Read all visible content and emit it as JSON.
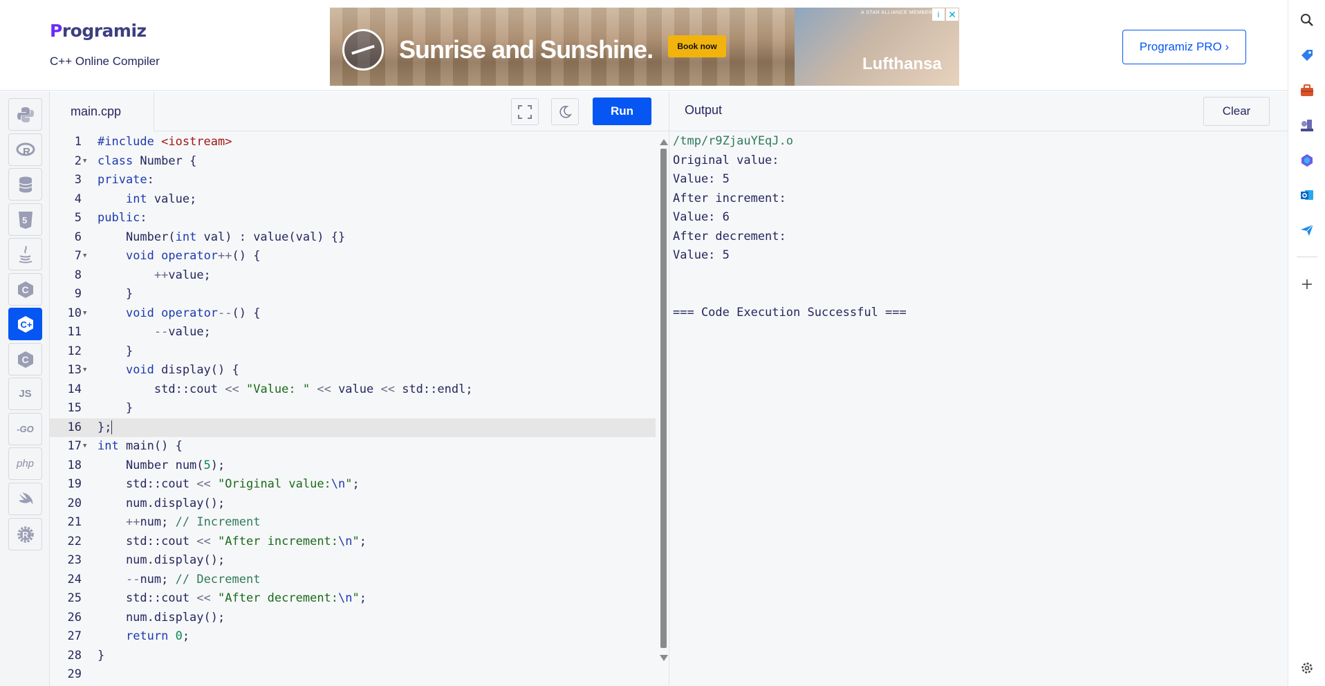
{
  "header": {
    "logo_p": "P",
    "logo_text": "rogramiz",
    "subtitle": "C++ Online Compiler",
    "pro_button": "Programiz PRO ›"
  },
  "ad": {
    "headline": "Sunrise and Sunshine.",
    "cta": "Book now",
    "brand": "Lufthansa",
    "small_text": "A STAR ALLIANCE MEMBER",
    "info": "i",
    "close": "✕"
  },
  "languages": [
    {
      "name": "python",
      "label": ""
    },
    {
      "name": "r",
      "label": "R"
    },
    {
      "name": "sql",
      "label": ""
    },
    {
      "name": "html",
      "label": "5"
    },
    {
      "name": "java",
      "label": ""
    },
    {
      "name": "c",
      "label": "C"
    },
    {
      "name": "cpp",
      "label": "C+",
      "active": true
    },
    {
      "name": "csharp",
      "label": "C"
    },
    {
      "name": "javascript",
      "label": "JS"
    },
    {
      "name": "go",
      "label": "-GO"
    },
    {
      "name": "php",
      "label": "php"
    },
    {
      "name": "swift",
      "label": ""
    },
    {
      "name": "rust",
      "label": "R"
    }
  ],
  "editor": {
    "filename": "main.cpp",
    "run_label": "Run",
    "active_line": 16,
    "line_numbers": [
      "1",
      "2",
      "3",
      "4",
      "5",
      "6",
      "7",
      "8",
      "9",
      "10",
      "11",
      "12",
      "13",
      "14",
      "15",
      "16",
      "17",
      "18",
      "19",
      "20",
      "21",
      "22",
      "23",
      "24",
      "25",
      "26",
      "27",
      "28",
      "29"
    ],
    "folds": [
      2,
      7,
      10,
      13,
      17
    ]
  },
  "output": {
    "title": "Output",
    "clear_label": "Clear",
    "lines": [
      "/tmp/r9ZjauYEqJ.o",
      "Original value:",
      "Value: 5",
      "After increment:",
      "Value: 6",
      "After decrement:",
      "Value: 5",
      "",
      "",
      "=== Code Execution Successful ==="
    ]
  },
  "browser_sidebar": {
    "icons": [
      "search-icon",
      "tag-icon",
      "toolbox-icon",
      "chess-icon",
      "copilot-icon",
      "outlook-icon",
      "send-icon",
      "add-icon",
      "settings-icon"
    ]
  },
  "colors": {
    "accent": "#0556f3",
    "text": "#25265e",
    "keyword": "#1c3ab0",
    "string": "#1a6a1a",
    "comment": "#2f7a5a"
  }
}
